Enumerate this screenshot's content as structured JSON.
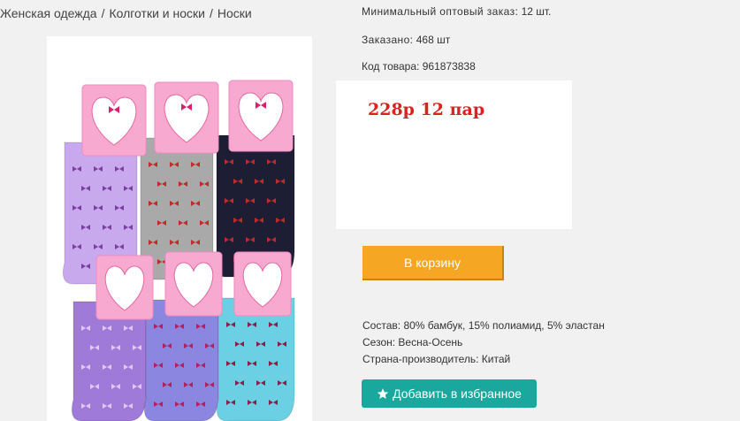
{
  "breadcrumb": {
    "items": [
      "Женская одежда",
      "Колготки и носки",
      "Носки"
    ],
    "separator": "/"
  },
  "product": {
    "image_alt": "Носки женские, 6 пар в упаковке",
    "sock_colors": [
      "#c9a9ee",
      "#a9a9a9",
      "#1d1d33",
      "#a07ad9",
      "#8b87e0",
      "#6bd0e4"
    ],
    "min_order": {
      "label": "Минимальный оптовый заказ:",
      "value": "12 шт."
    },
    "ordered": {
      "label": "Заказано:",
      "value": "468 шт"
    },
    "code": {
      "label": "Код товара:",
      "value": "961873838"
    },
    "price_text": "228р 12 пар",
    "cart_button_label": "В корзину",
    "specs": {
      "composition": {
        "label": "Состав:",
        "value": "80% бамбук, 15% полиамид, 5% эластан"
      },
      "season": {
        "label": "Сезон:",
        "value": "Весна-Осень"
      },
      "country": {
        "label": "Страна-производитель:",
        "value": "Китай"
      }
    },
    "favorite_button_label": "Добавить в избранное"
  },
  "colors": {
    "page_bg": "#f1f1f1",
    "price": "#d9231e",
    "cart_button": "#f5a623",
    "favorite_button": "#1aa89e"
  },
  "icons": {
    "favorite": "star-icon"
  }
}
